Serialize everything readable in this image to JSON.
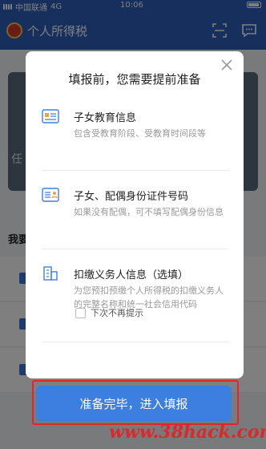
{
  "status_bar": {
    "carrier": "中国联通",
    "network": "4G",
    "time": "10:06"
  },
  "app": {
    "title": "个人所得税"
  },
  "background": {
    "banner_fragment": "任",
    "section_fragment": "我要"
  },
  "dialog": {
    "title": "填报前，您需要提前准备",
    "items": [
      {
        "icon": "education-card-icon",
        "title": "子女教育信息",
        "desc": "包含受教育阶段、受教育时间段等"
      },
      {
        "icon": "id-card-icon",
        "title": "子女、配偶身份证件号码",
        "desc": "如果没有配偶，可不填写配偶身份信息"
      },
      {
        "icon": "building-icon",
        "title": "扣缴义务人信息（选填）",
        "desc": "为您预扣预缴个人所得税的扣缴义务人的完整名称和统一社会信用代码"
      }
    ],
    "checkbox_label": "下次不再提示",
    "confirm_button": "准备完毕，进入填报"
  },
  "watermark": "www.38hack.com",
  "colors": {
    "brand_blue": "#2c5fb8",
    "button_blue": "#3d7fe0",
    "highlight_red": "#e0262b"
  }
}
